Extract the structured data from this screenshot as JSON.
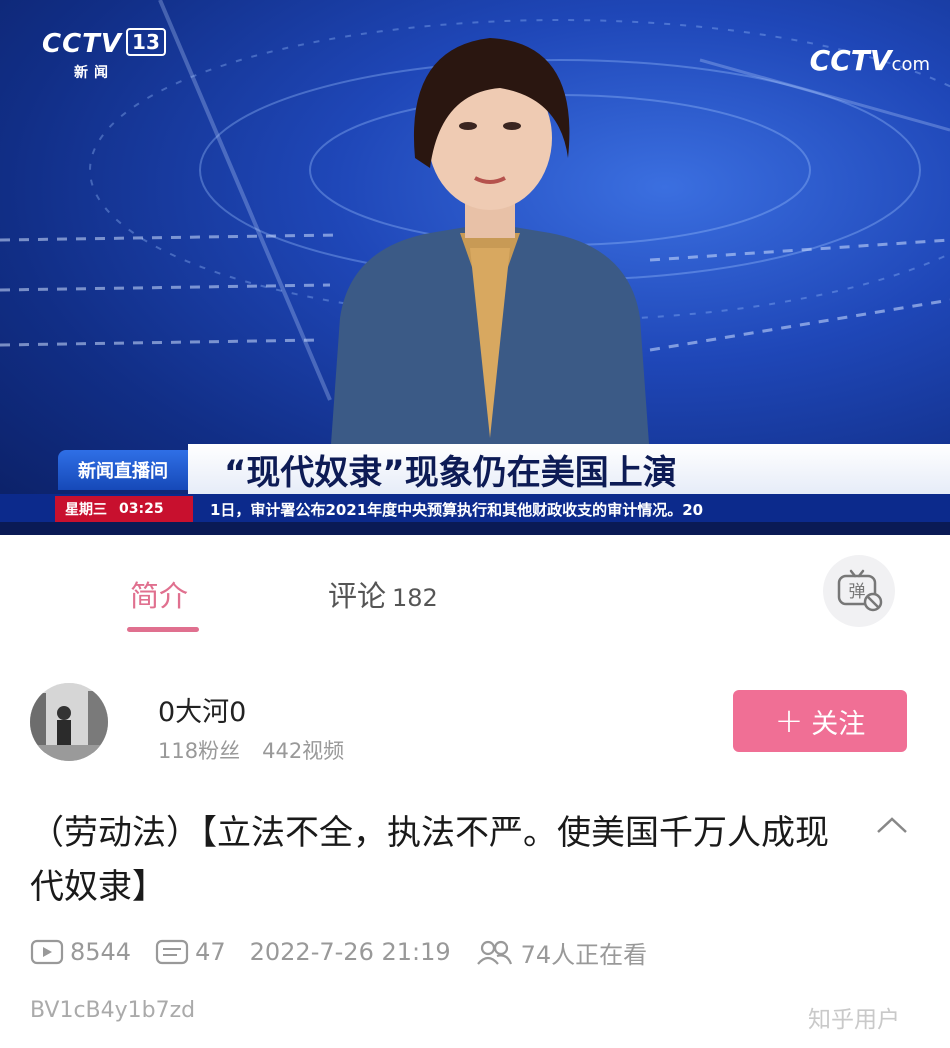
{
  "video": {
    "channel_logo": "CCTV 13",
    "channel_number": "13",
    "channel_sub": "新闻",
    "corner_logo": "CCTV",
    "corner_logo_suffix": "com",
    "program_tag": "新闻直播间",
    "headline": "“现代奴隶”现象仍在美国上演",
    "weekday": "星期三",
    "time": "03:25",
    "ticker": "1日，审计署公布2021年度中央预算执行和其他财政收支的审计情况。20",
    "colors": {
      "lower_third_blue": "#0c2a8c",
      "clock_red": "#c8102e"
    }
  },
  "tabs": {
    "intro_label": "简介",
    "comments_label": "评论",
    "comments_count": "182",
    "danmaku_icon": "danmaku-toggle-icon",
    "danmaku_glyph": "弹",
    "active_color": "#e0708f"
  },
  "uploader": {
    "name": "0大河0",
    "followers": "118粉丝",
    "videos": "442视频",
    "follow_plus": "+",
    "follow_label": "关注",
    "follow_color": "#f06f95"
  },
  "video_info": {
    "title": "（劳动法）【立法不全，执法不严。使美国千万人成现代奴隶】",
    "plays": "8544",
    "danmaku_count": "47",
    "datetime": "2022-7-26 21:19",
    "watching": "74人正在看",
    "bvid": "BV1cB4y1b7zd"
  },
  "watermark": "知乎用户"
}
